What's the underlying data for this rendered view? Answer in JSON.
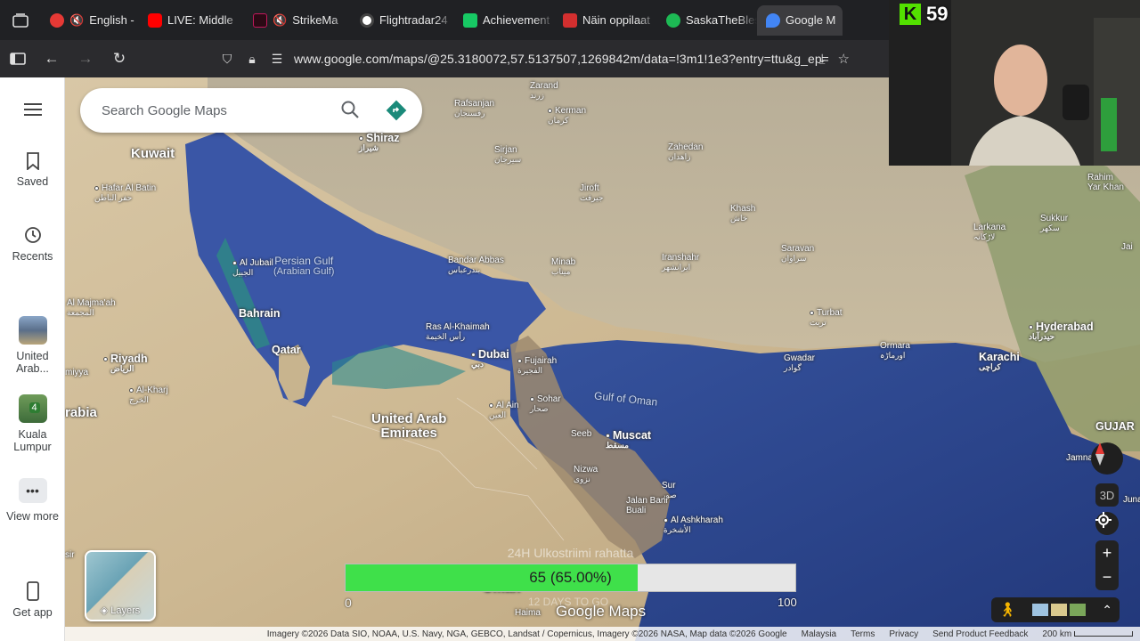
{
  "browser": {
    "tabs": [
      {
        "label": "English -",
        "color": "#e53935"
      },
      {
        "label": "LIVE: Middle",
        "color": "#ff0000"
      },
      {
        "label": "StrikeMa",
        "color": "#c2185b"
      },
      {
        "label": "Flightradar24",
        "color": "#666666"
      },
      {
        "label": "Achievement",
        "color": "#17c964"
      },
      {
        "label": "Näin oppilaat",
        "color": "#d32f2f"
      },
      {
        "label": "SaskaTheBles",
        "color": "#1db954"
      },
      {
        "label": "Google M",
        "color": "#4285f4"
      }
    ],
    "url": "www.google.com/maps/@25.3180072,57.5137507,1269842m/data=!3m1!1e3?entry=ttu&g_ep="
  },
  "rail": {
    "saved": "Saved",
    "recents": "Recents",
    "recent1": "United Arab...",
    "recent2_badge": "4",
    "recent2": "Kuala Lumpur",
    "view_more": "View more",
    "get_app": "Get app"
  },
  "search": {
    "placeholder": "Search Google Maps"
  },
  "layers": {
    "label": "Layers"
  },
  "controls": {
    "three_d": "3D"
  },
  "places": {
    "kuwait": "Kuwait",
    "hafar": "Hafar Al Batin",
    "hafar_ar": "حفر الباطن",
    "jubail": "Al Jubail",
    "jubail_ar": "الجبيل",
    "majmaah": "Al Majma'ah",
    "majmaah_ar": "المجمعة",
    "bahrain": "Bahrain",
    "qatar": "Qatar",
    "riyadh": "Riyadh",
    "riyadh_ar": "الرياض",
    "kharj": "Al-Kharj",
    "kharj_ar": "الخرج",
    "miyya": "miyya",
    "arabia": "rabia",
    "persian_gulf": "Persian Gulf",
    "persian_gulf2": "(Arabian Gulf)",
    "shiraz": "Shiraz",
    "shiraz_ar": "شیراز",
    "rafsanjan": "Rafsanjan",
    "rafsanjan_ar": "رفسنجان",
    "zarand": "Zarand",
    "zarand_ar": "زرند",
    "kerman": "Kerman",
    "kerman_ar": "کرمان",
    "sirjan": "Sirjan",
    "sirjan_ar": "سیرجان",
    "jiroft": "Jiroft",
    "jiroft_ar": "جیرفت",
    "zahedan": "Zahedan",
    "zahedan_ar": "زاهدان",
    "khash": "Khash",
    "khash_ar": "خاش",
    "saravan": "Saravan",
    "saravan_ar": "سراوان",
    "bandar": "Bandar Abbas",
    "bandar_ar": "بندرعباس",
    "minab": "Minab",
    "minab_ar": "میناب",
    "iranshahr": "Iranshahr",
    "iranshahr_ar": "ایرانشهر",
    "turbat": "Turbat",
    "turbat_ar": "تربت",
    "gwadar": "Gwadar",
    "gwadar_ar": "گوادر",
    "ormara": "Ormara",
    "ormara_ar": "اورماڑہ",
    "karachi": "Karachi",
    "karachi_ar": "کراچی",
    "hyderabad": "Hyderabad",
    "hyderabad_ar": "حیدرآباد",
    "larkana": "Larkana",
    "larkana_ar": "لاڑکانہ",
    "sukkur": "Sukkur",
    "sukkur_ar": "سکھر",
    "rahim": "Rahim",
    "rahim2": "Yar Khan",
    "jai": "Jai",
    "gujar": "GUJAR",
    "jamnagar": "Jamnag",
    "juna": "Juna",
    "ras_khaimah": "Ras Al-Khaimah",
    "ras_khaimah_ar": "رأس الخيمة",
    "dubai": "Dubai",
    "dubai_ar": "دبي",
    "fujairah": "Fujairah",
    "fujairah_ar": "الفجيرة",
    "uae1": "United Arab",
    "uae2": "Emirates",
    "al_ain": "Al Ain",
    "al_ain_ar": "العين",
    "sohar": "Sohar",
    "sohar_ar": "صحار",
    "gulf_oman": "Gulf of Oman",
    "seeb": "Seeb",
    "muscat": "Muscat",
    "muscat_ar": "مسقط",
    "nizwa": "Nizwa",
    "nizwa_ar": "نزوى",
    "sur": "Sur",
    "sur_ar": "صور",
    "jalan": "Jalan Bani",
    "jalan2": "Buali",
    "ashkharah": "Al Ashkharah",
    "ashkharah_ar": "الأشخرة",
    "haima": "Haima",
    "oman": "Oman",
    "sir": "sir"
  },
  "goal": {
    "title": "24H Ulkostriimi rahatta",
    "value_text": "65 (65.00%)",
    "fraction": 0.65,
    "min": "0",
    "max": "100",
    "sub": "12 DAYS TO GO"
  },
  "logo": "Google Maps",
  "footer": {
    "attribution": "Imagery ©2026 Data SIO, NOAA, U.S. Navy, NGA, GEBCO, Landsat / Copernicus, Imagery ©2026 NASA, Map data ©2026 Google",
    "region": "Malaysia",
    "terms": "Terms",
    "privacy": "Privacy",
    "feedback": "Send Product Feedback",
    "scale": "200 km"
  },
  "webcam": {
    "badge_letter": "K",
    "count": "59"
  },
  "colors": {
    "accent_green": "#3fe04a",
    "water": "#2f4f9a"
  }
}
